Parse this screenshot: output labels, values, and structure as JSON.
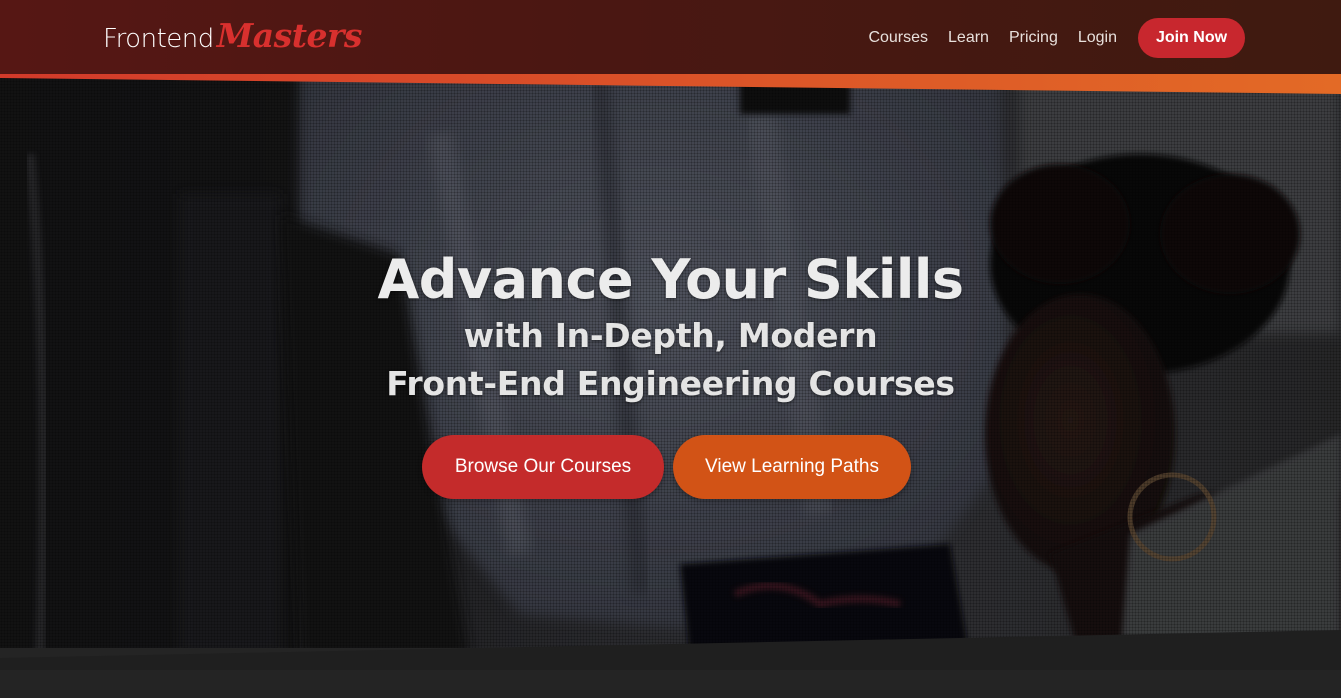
{
  "header": {
    "logo": {
      "part1": "Frontend",
      "part2": "Masters"
    },
    "nav": [
      {
        "label": "Courses"
      },
      {
        "label": "Learn"
      },
      {
        "label": "Pricing"
      },
      {
        "label": "Login"
      }
    ],
    "join_label": "Join Now"
  },
  "hero": {
    "title": "Advance Your Skills",
    "subtitle_line1": "with In-Depth, Modern",
    "subtitle_line2": "Front-End Engineering Courses",
    "browse_label": "Browse Our Courses",
    "paths_label": "View Learning Paths"
  },
  "colors": {
    "header_bg": "#4f1813",
    "brand_red": "#c8272e",
    "accent_orange": "#d25316",
    "logo_red": "#d8302e"
  }
}
